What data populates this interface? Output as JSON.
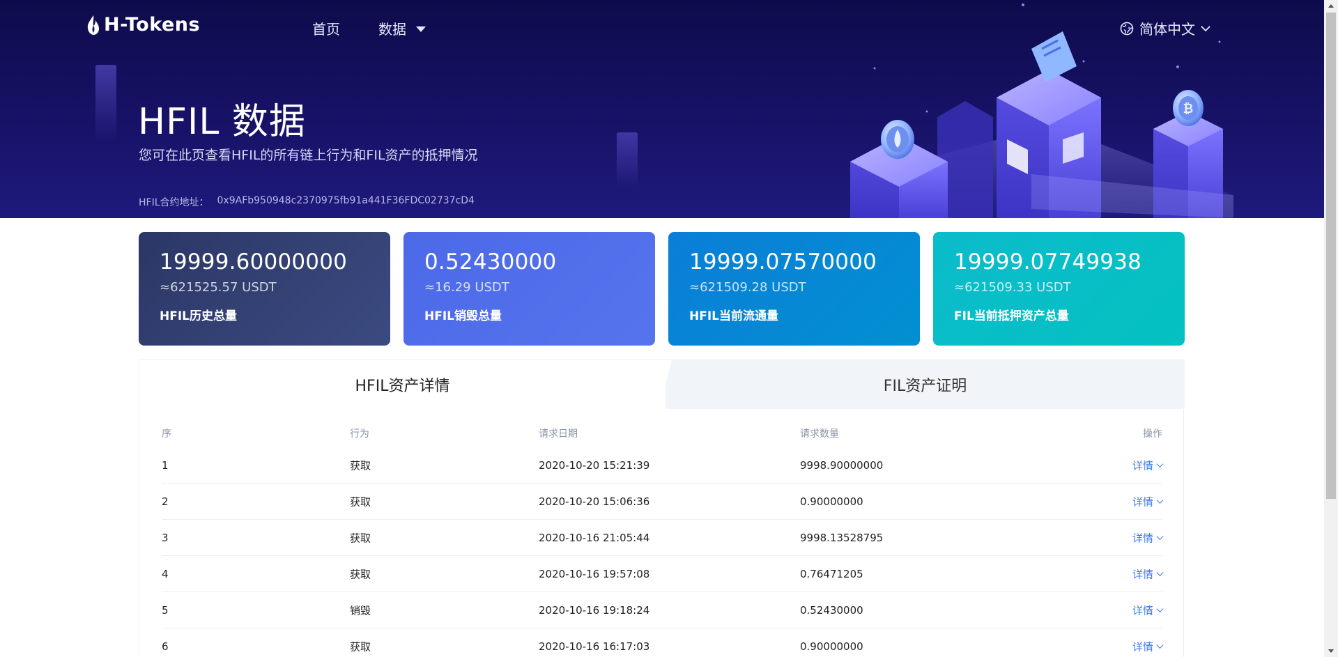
{
  "nav": {
    "logo_text": "H-Tokens",
    "home_label": "首页",
    "data_label": "数据",
    "language_label": "简体中文"
  },
  "hero": {
    "title": "HFIL 数据",
    "subtitle": "您可在此页查看HFIL的所有链上行为和FIL资产的抵押情况",
    "contract_label": "HFIL合约地址：",
    "contract_address": "0x9AFb950948c2370975fb91a441F36FDC02737cD4"
  },
  "stats": [
    {
      "value": "19999.60000000",
      "usdt": "≈621525.57 USDT",
      "label": "HFIL历史总量"
    },
    {
      "value": "0.52430000",
      "usdt": "≈16.29 USDT",
      "label": "HFIL销毁总量"
    },
    {
      "value": "19999.07570000",
      "usdt": "≈621509.28 USDT",
      "label": "HFIL当前流通量"
    },
    {
      "value": "19999.07749938",
      "usdt": "≈621509.33 USDT",
      "label": "FIL当前抵押资产总量"
    }
  ],
  "tabs": {
    "active": "HFIL资产详情",
    "inactive": "FIL资产证明"
  },
  "table": {
    "headers": {
      "idx": "序",
      "action": "行为",
      "date": "请求日期",
      "amount": "请求数量",
      "op": "操作"
    },
    "rows": [
      {
        "idx": "1",
        "action": "获取",
        "date": "2020-10-20 15:21:39",
        "amount": "9998.90000000",
        "op": "详情"
      },
      {
        "idx": "2",
        "action": "获取",
        "date": "2020-10-20 15:06:36",
        "amount": "0.90000000",
        "op": "详情"
      },
      {
        "idx": "3",
        "action": "获取",
        "date": "2020-10-16 21:05:44",
        "amount": "9998.13528795",
        "op": "详情"
      },
      {
        "idx": "4",
        "action": "获取",
        "date": "2020-10-16 19:57:08",
        "amount": "0.76471205",
        "op": "详情"
      },
      {
        "idx": "5",
        "action": "销毁",
        "date": "2020-10-16 19:18:24",
        "amount": "0.52430000",
        "op": "详情"
      },
      {
        "idx": "6",
        "action": "获取",
        "date": "2020-10-16 16:17:03",
        "amount": "0.90000000",
        "op": "详情"
      }
    ]
  },
  "colors": {
    "hero_bg": "#171266",
    "link": "#3d7be8",
    "card1": "#2f3b6f",
    "card2": "#4f6cea",
    "card3": "#0685d4",
    "card4": "#08bec6"
  },
  "icons": [
    "flame-logo-icon",
    "globe-icon",
    "chevron-down-icon",
    "caret-down-icon"
  ]
}
